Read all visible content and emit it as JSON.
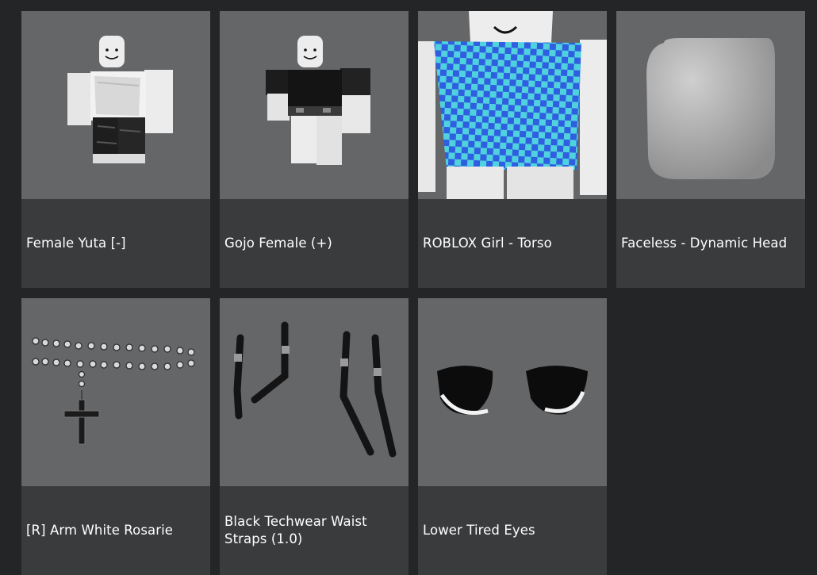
{
  "catalog": {
    "items": [
      {
        "name": "Female Yuta [-]",
        "icon": "avatar-white-outfit-icon"
      },
      {
        "name": "Gojo Female (+)",
        "icon": "avatar-black-shirt-icon"
      },
      {
        "name": "ROBLOX Girl - Torso",
        "icon": "checkered-torso-icon"
      },
      {
        "name": "Faceless - Dynamic Head",
        "icon": "blank-head-icon"
      },
      {
        "name": "[R] Arm White Rosarie",
        "icon": "rosary-cross-icon"
      },
      {
        "name": "Black  Techwear Waist Straps (1.0)",
        "icon": "waist-straps-icon"
      },
      {
        "name": "Lower Tired Eyes",
        "icon": "tired-eyes-icon"
      }
    ]
  },
  "colors": {
    "background": "#232527",
    "card": "#393b3d",
    "thumbnail": "#656668",
    "text": "#ffffff"
  }
}
